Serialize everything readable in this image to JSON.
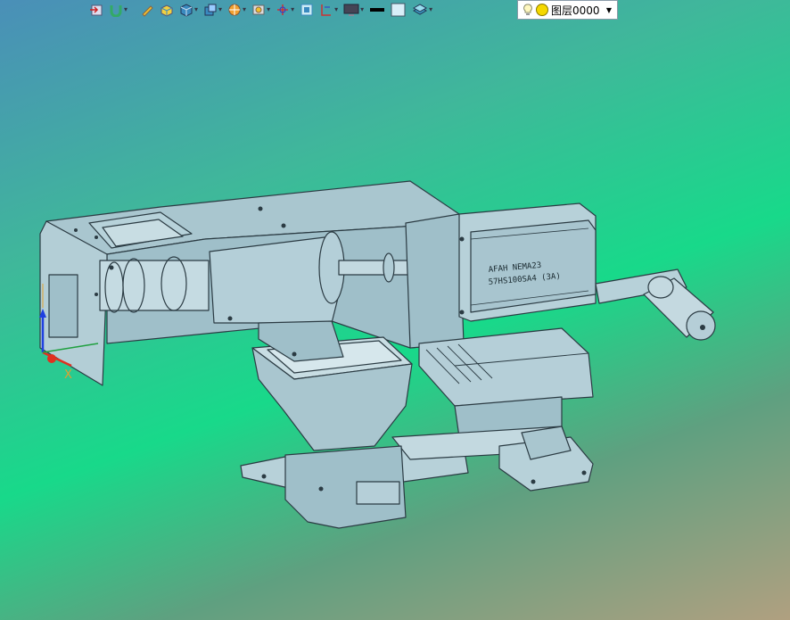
{
  "toolbar": {
    "icons": [
      "import-icon",
      "magnet-icon",
      "pencil-icon",
      "box-icon",
      "cube-icon",
      "view-cube-icon",
      "render-icon",
      "camera-icon",
      "axis-icon",
      "frame-icon",
      "section-icon",
      "display-icon",
      "line-color-icon",
      "fill-color-icon",
      "layer-stack-icon"
    ],
    "layer_value": "图层0000"
  },
  "model": {
    "motor_label_line1": "AFAH NEMA23",
    "motor_label_line2": "57HS100SA4 (3A)"
  },
  "colors": {
    "part_fill": "#a9c6cf",
    "part_dark": "#8fb0bb",
    "part_edge": "#2b3b43",
    "axis_x": "#e03020",
    "axis_y": "#20a040",
    "axis_z": "#2040e0"
  }
}
